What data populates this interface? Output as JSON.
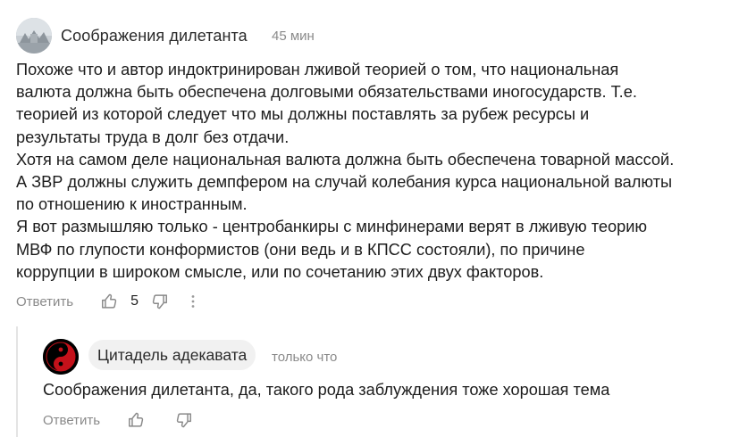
{
  "comment": {
    "author": "Соображения дилетанта",
    "time": "45 мин",
    "lines": [
      "Похоже что и автор индоктринирован лживой теорией о том, что национальная",
      "валюта должна быть обеспечена долговыми обязательствами иногосударств. Т.е.",
      "теорией из которой следует что мы должны поставлять за рубеж ресурсы и",
      "результаты труда в долг без отдачи.",
      "Хотя на самом деле национальная валюта должна быть обеспечена товарной массой.",
      "А ЗВР должны служить демпфером на случай колебания курса национальной валюты",
      "по отношению к иностранным.",
      "Я вот размышляю только - центробанкиры с минфинерами верят в лживую теорию",
      "МВФ по глупости конформистов (они ведь и в КПСС состояли), по причине",
      "коррупции в широком смысле, или по сочетанию этих двух факторов."
    ],
    "reply_label": "Ответить",
    "likes": "5",
    "icons": {
      "like": "thumbs-up-icon",
      "dislike": "thumbs-down-icon",
      "more": "more-options-icon"
    }
  },
  "reply": {
    "author": "Цитадель адекавата",
    "time": "только что",
    "text": "Соображения дилетанта, да, такого рода заблуждения тоже хорошая тема",
    "reply_label": "Ответить",
    "colors": {
      "avatar_red": "#c4111a",
      "avatar_black": "#000000"
    }
  }
}
